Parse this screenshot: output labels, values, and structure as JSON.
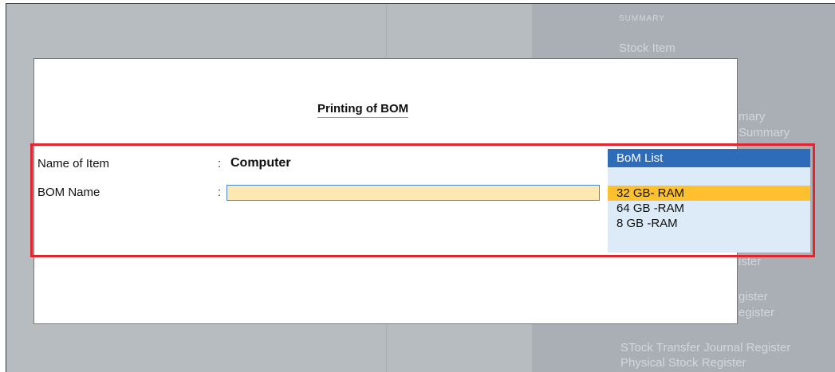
{
  "background": {
    "summary_heading": "SUMMARY",
    "stock_item": "Stock Item",
    "partial_1": "mary",
    "partial_2": "Summary",
    "partial_3": "ister",
    "partial_4": "gister",
    "partial_5": "egister",
    "stock_transfer": "STock Transfer Journal Register",
    "physical_stock": "Physical Stock Register"
  },
  "dialog": {
    "title": "Printing of BOM",
    "name_label": "Name of Item",
    "name_value": "Computer",
    "bom_label": "BOM Name",
    "colon": ":",
    "bom_value": ""
  },
  "bom_list": {
    "header": "BoM List",
    "items": [
      "32 GB- RAM",
      "64 GB -RAM",
      "8 GB -RAM"
    ],
    "selected_index": 0
  },
  "colors": {
    "highlight_border": "#e0252e",
    "list_header": "#2e6bb8",
    "selected_item": "#fdc130",
    "input_fill": "#fde8b3"
  }
}
